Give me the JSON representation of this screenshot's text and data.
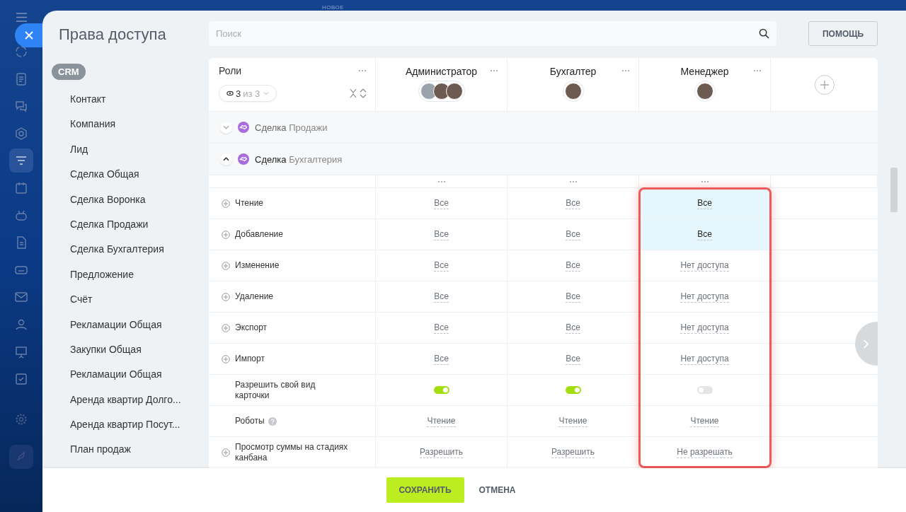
{
  "background_label": "НОВОЕ",
  "title": "Права доступа",
  "search": {
    "placeholder": "Поиск"
  },
  "help_button": "ПОМОЩЬ",
  "nav": {
    "group": "CRM",
    "items": [
      {
        "label": "Контакт"
      },
      {
        "label": "Компания"
      },
      {
        "label": "Лид"
      },
      {
        "label": "Сделка Общая"
      },
      {
        "label": "Сделка Воронка"
      },
      {
        "label": "Сделка Продажи"
      },
      {
        "label": "Сделка Бухгалтерия"
      },
      {
        "label": "Предложение"
      },
      {
        "label": "Счёт"
      },
      {
        "label": "Рекламации Общая"
      },
      {
        "label": "Закупки Общая"
      },
      {
        "label": "Рекламации Общая"
      },
      {
        "label": "Аренда квартир Долго..."
      },
      {
        "label": "Аренда квартир Посут..."
      },
      {
        "label": "План продаж"
      }
    ]
  },
  "table": {
    "roles_heading": "Роли",
    "counter": {
      "shown": "3",
      "total": "из 3"
    },
    "roles": [
      {
        "name": "Администратор",
        "outlined": false,
        "avatars": [
          {
            "kind": "user"
          },
          {
            "kind": "photo"
          },
          {
            "kind": "photo"
          }
        ]
      },
      {
        "name": "Бухгалтер",
        "outlined": false,
        "avatars": [
          {
            "kind": "photo"
          }
        ]
      },
      {
        "name": "Менеджер",
        "outlined": true,
        "avatars": [
          {
            "kind": "photo"
          }
        ]
      }
    ],
    "sections": [
      {
        "entity": "Сделка",
        "name": "Продажи",
        "expanded": false
      },
      {
        "entity": "Сделка",
        "name": "Бухгалтерия",
        "expanded": true
      }
    ],
    "rows": [
      {
        "label": "Чтение",
        "kind": "select",
        "expandable": true,
        "help": false,
        "cells": [
          {
            "value": "Все",
            "highlighted": false
          },
          {
            "value": "Все",
            "highlighted": false
          },
          {
            "value": "Все",
            "highlighted": true
          }
        ]
      },
      {
        "label": "Добавление",
        "kind": "select",
        "expandable": true,
        "help": false,
        "cells": [
          {
            "value": "Все",
            "highlighted": false
          },
          {
            "value": "Все",
            "highlighted": false
          },
          {
            "value": "Все",
            "highlighted": true
          }
        ]
      },
      {
        "label": "Изменение",
        "kind": "select",
        "expandable": true,
        "help": false,
        "cells": [
          {
            "value": "Все",
            "highlighted": false
          },
          {
            "value": "Все",
            "highlighted": false
          },
          {
            "value": "Нет доступа",
            "highlighted": false
          }
        ]
      },
      {
        "label": "Удаление",
        "kind": "select",
        "expandable": true,
        "help": false,
        "cells": [
          {
            "value": "Все",
            "highlighted": false
          },
          {
            "value": "Все",
            "highlighted": false
          },
          {
            "value": "Нет доступа",
            "highlighted": false
          }
        ]
      },
      {
        "label": "Экспорт",
        "kind": "select",
        "expandable": true,
        "help": false,
        "cells": [
          {
            "value": "Все",
            "highlighted": false
          },
          {
            "value": "Все",
            "highlighted": false
          },
          {
            "value": "Нет доступа",
            "highlighted": false
          }
        ]
      },
      {
        "label": "Импорт",
        "kind": "select",
        "expandable": true,
        "help": false,
        "cells": [
          {
            "value": "Все",
            "highlighted": false
          },
          {
            "value": "Все",
            "highlighted": false
          },
          {
            "value": "Нет доступа",
            "highlighted": false
          }
        ]
      },
      {
        "label": "Разрешить свой вид карточки",
        "kind": "toggle",
        "expandable": false,
        "help": false,
        "cells": [
          {
            "on": true,
            "highlighted": false
          },
          {
            "on": true,
            "highlighted": false
          },
          {
            "on": false,
            "highlighted": false
          }
        ]
      },
      {
        "label": "Роботы",
        "kind": "select",
        "expandable": false,
        "help": true,
        "cells": [
          {
            "value": "Чтение",
            "highlighted": false
          },
          {
            "value": "Чтение",
            "highlighted": false
          },
          {
            "value": "Чтение",
            "highlighted": false
          }
        ]
      },
      {
        "label": "Просмотр суммы на стадиях канбана",
        "kind": "select",
        "expandable": true,
        "help": false,
        "cells": [
          {
            "value": "Разрешить",
            "highlighted": false
          },
          {
            "value": "Разрешить",
            "highlighted": false
          },
          {
            "value": "Не разрешать",
            "highlighted": false
          }
        ]
      }
    ]
  },
  "footer": {
    "save": "СОХРАНИТЬ",
    "cancel": "ОТМЕНА"
  }
}
